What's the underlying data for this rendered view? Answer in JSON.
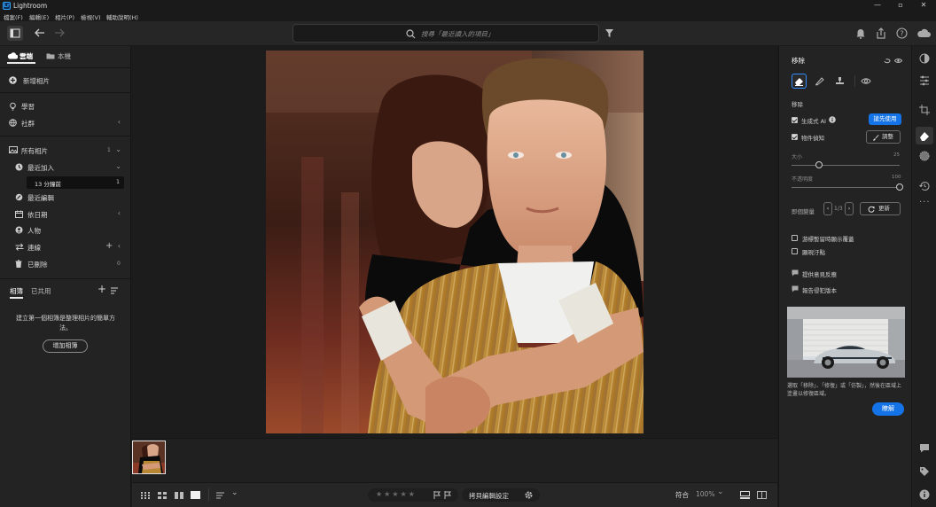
{
  "app": {
    "title": "Lightroom",
    "logo": "Lr"
  },
  "window_controls": {
    "minimize": "—",
    "maximize": "▫",
    "close": "✕"
  },
  "menu": [
    "檔案(F)",
    "編輯(E)",
    "相片(P)",
    "檢視(V)",
    "輔助說明(H)"
  ],
  "search": {
    "placeholder": "搜尋「最近讀入的項目」"
  },
  "left_panel": {
    "tabs": {
      "cloud": "雲端",
      "local": "本機"
    },
    "add_photos": "新增相片",
    "learn": "學習",
    "community": "社群",
    "all_photos": "所有相片",
    "all_photos_count": "1",
    "recently_added": "最近加入",
    "recently_added_sub": "13 分鐘前",
    "recently_added_sub_count": "1",
    "recently_edited": "最近編輯",
    "by_date": "依日期",
    "people": "人物",
    "connections": "連線",
    "deleted": "已刪除",
    "deleted_count": "0",
    "album_tabs": {
      "albums": "相簿",
      "shared": "已共用"
    },
    "empty_albums_text": "建立第一個相簿是整理相片的簡單方法。",
    "add_album_button": "增加相簿"
  },
  "bottom_bar": {
    "copy_edit_settings": "拷貝編輯設定",
    "fit": "符合",
    "zoom": "100%"
  },
  "right_panel": {
    "title": "移除",
    "section_label": "移除",
    "generative_ai": "生成式 AI",
    "preview_badge": "搶先使用",
    "object_aware": "物件偵知",
    "adjust_button": "調整",
    "size_label": "大小",
    "size_value": "25",
    "opacity_label": "不透明度",
    "opacity_value": "100",
    "variations_label": "即個變量",
    "variations_value": "1/3",
    "refresh_button": "更新",
    "show_overlay": "游標暫留時顯示覆蓋",
    "reflect_stain": "顯現汙點",
    "feedback": "提供意見反應",
    "report": "報告侵犯版本",
    "tip_text": "選取「移除」、「修復」或「仿製」，然後在區域上塗畫以修復區域。",
    "learn_button": "瞭解"
  },
  "slider_levels": {
    "size": 0.25,
    "opacity": 1.0
  },
  "colors": {
    "accent": "#1473e6",
    "panel": "#232323",
    "rail": "#1f1f1f"
  }
}
